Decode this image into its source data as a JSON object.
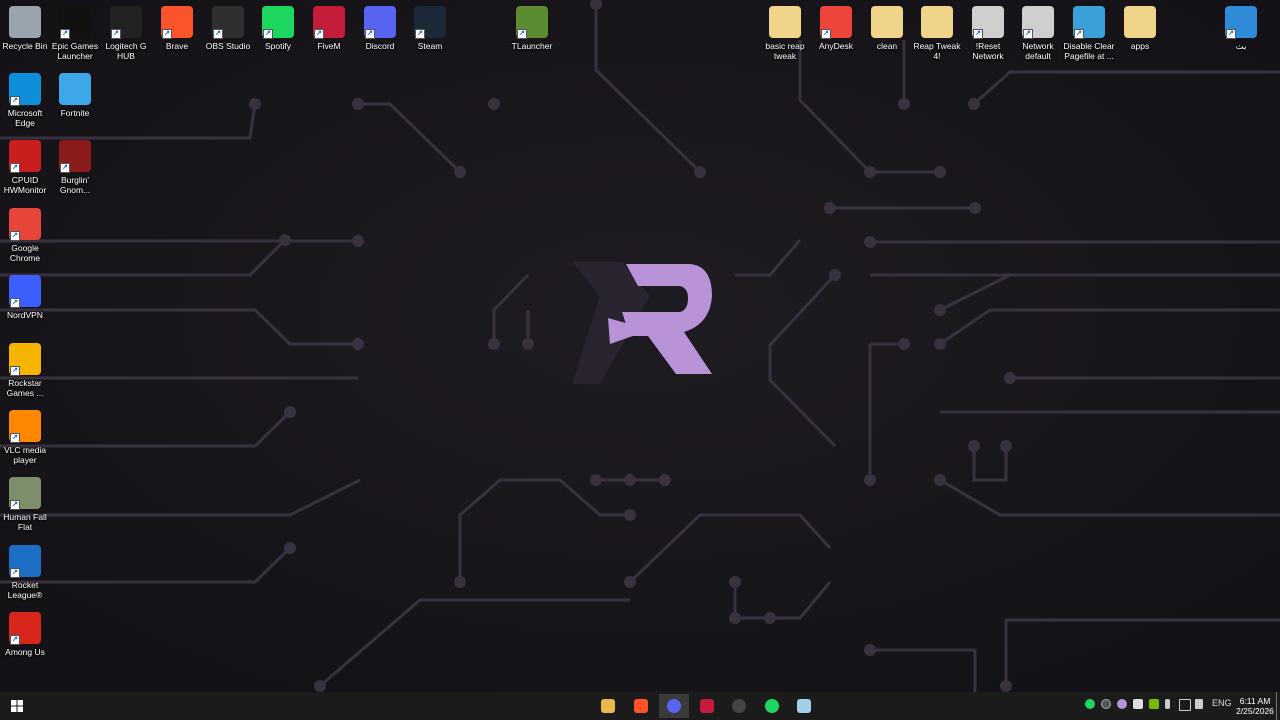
{
  "desktop": {
    "icons_top": [
      {
        "label": "Recycle Bin",
        "icon": "recycle-bin-icon",
        "color": "#9aa4ad"
      },
      {
        "label": "Epic Games Launcher",
        "icon": "epic-games-icon",
        "color": "#111111"
      },
      {
        "label": "Logitech G HUB",
        "icon": "logitech-icon",
        "color": "#222222"
      },
      {
        "label": "Brave",
        "icon": "brave-icon",
        "color": "#fb542b"
      },
      {
        "label": "OBS Studio",
        "icon": "obs-icon",
        "color": "#302e31"
      },
      {
        "label": "Spotify",
        "icon": "spotify-icon",
        "color": "#1ed760"
      },
      {
        "label": "FiveM",
        "icon": "fivem-icon",
        "color": "#c41c3b"
      },
      {
        "label": "Discord",
        "icon": "discord-icon",
        "color": "#5865f2"
      },
      {
        "label": "Steam",
        "icon": "steam-icon",
        "color": "#1b2838"
      },
      {
        "label": "TLauncher",
        "icon": "minecraft-icon",
        "color": "#5b8c32"
      }
    ],
    "icons_left": [
      {
        "label": "Microsoft Edge",
        "icon": "edge-icon",
        "color": "#0f8fd8"
      },
      {
        "label": "CPUID HWMonitor",
        "icon": "hwmonitor-icon",
        "color": "#c81e1e"
      },
      {
        "label": "Google Chrome",
        "icon": "chrome-icon",
        "color": "#e7443a"
      },
      {
        "label": "NordVPN",
        "icon": "nordvpn-icon",
        "color": "#3e5fff"
      },
      {
        "label": "Rockstar Games ...",
        "icon": "rockstar-icon",
        "color": "#f4b400"
      },
      {
        "label": "VLC media player",
        "icon": "vlc-icon",
        "color": "#ff8800"
      },
      {
        "label": "Human Fall Flat",
        "icon": "human-fall-flat-icon",
        "color": "#7d8f6a"
      },
      {
        "label": "Rocket League®",
        "icon": "rocket-league-icon",
        "color": "#1c6fc4"
      },
      {
        "label": "Among Us",
        "icon": "among-us-icon",
        "color": "#d9261c"
      }
    ],
    "icons_second_col": [
      {
        "label": "Fortnite",
        "icon": "fortnite-icon",
        "color": "#3ea7e8"
      },
      {
        "label": "Burglin' Gnom...",
        "icon": "burglin-gnomes-icon",
        "color": "#8c1c1c"
      }
    ],
    "icons_right": [
      {
        "label": "basic reap tweak",
        "icon": "folder-icon",
        "color": "#f0d48a"
      },
      {
        "label": "AnyDesk",
        "icon": "anydesk-icon",
        "color": "#ef443b"
      },
      {
        "label": "clean",
        "icon": "folder-icon",
        "color": "#f0d48a"
      },
      {
        "label": "Reap Tweak 4!",
        "icon": "folder-icon",
        "color": "#f0d48a"
      },
      {
        "label": "!Reset Network",
        "icon": "batch-file-icon",
        "color": "#cfcfcf"
      },
      {
        "label": "Network default",
        "icon": "batch-file-icon",
        "color": "#cfcfcf"
      },
      {
        "label": "Disable Clear Pagefile at ...",
        "icon": "registry-icon",
        "color": "#3aa0d8"
      },
      {
        "label": "apps",
        "icon": "folder-icon",
        "color": "#f0d48a"
      },
      {
        "label": "بث",
        "icon": "window-icon",
        "color": "#2f8ad8"
      }
    ]
  },
  "wallpaper": {
    "accent": "#b893d8",
    "dark_accent": "#3a3140"
  },
  "taskbar": {
    "apps": [
      {
        "name": "file-explorer-icon",
        "color": "#e8b84a"
      },
      {
        "name": "brave-icon",
        "color": "#fb542b"
      },
      {
        "name": "discord-icon",
        "color": "#5865f2"
      },
      {
        "name": "fivem-icon",
        "color": "#c41c3b"
      },
      {
        "name": "obs-icon",
        "color": "#444444"
      },
      {
        "name": "spotify-icon",
        "color": "#1ed760"
      },
      {
        "name": "notepad-icon",
        "color": "#9fd0e8"
      }
    ],
    "language": "ENG",
    "time": "6:11 AM",
    "date": "2/25/2026"
  }
}
